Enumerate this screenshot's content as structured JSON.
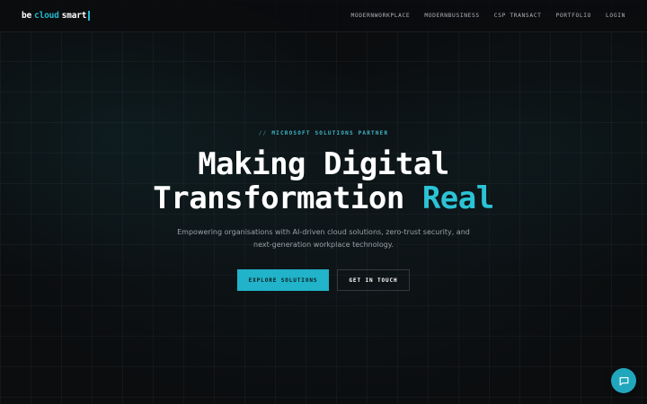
{
  "logo": {
    "be": "be",
    "cloud": "cloud",
    "smart": "smart"
  },
  "nav": {
    "items": [
      {
        "label": "MODERNWORKPLACE"
      },
      {
        "label": "MODERNBUSINESS"
      },
      {
        "label": "CSP TRANSACT"
      },
      {
        "label": "PORTFOLIO"
      },
      {
        "label": "LOGIN"
      }
    ]
  },
  "hero": {
    "eyebrow_slash": "//",
    "eyebrow_text": "MICROSOFT SOLUTIONS PARTNER",
    "headline_line1": "Making Digital",
    "headline_line2_main": "Transformation",
    "headline_line2_accent": "Real",
    "subtitle_line1": "Empowering organisations with AI-driven cloud solutions, zero-trust security, and",
    "subtitle_line2": "next-generation workplace technology.",
    "primary_button": "EXPLORE SOLUTIONS",
    "secondary_button": "GET IN TOUCH"
  },
  "chat": {
    "icon": "chat-bubble-icon"
  },
  "colors": {
    "accent": "#21b3c9",
    "background": "#0b0d0f"
  }
}
